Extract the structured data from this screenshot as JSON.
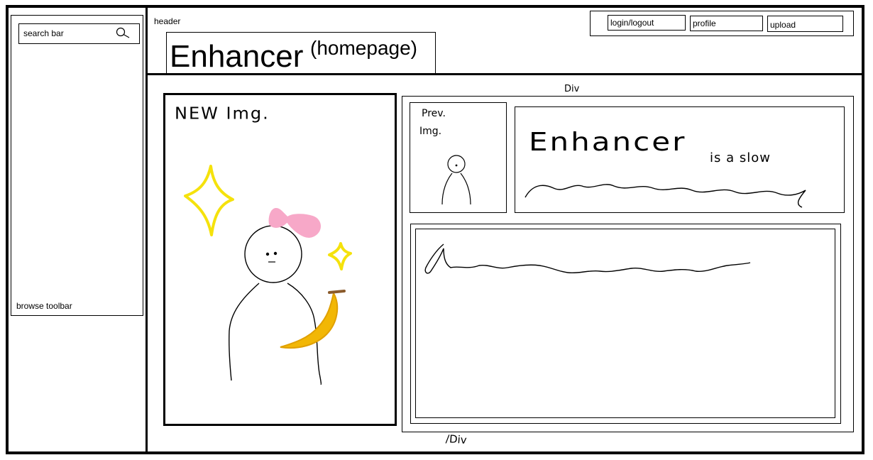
{
  "sidebar": {
    "search_label": "search bar",
    "search_icon": "search-icon",
    "browse_label": "browse toolbar"
  },
  "header": {
    "label": "header",
    "title": "Enhancer",
    "subtitle": "(homepage)"
  },
  "nav": {
    "login": "login/logout",
    "profile": "profile",
    "upload": "upload"
  },
  "main": {
    "new_img_label": "NEW Img.",
    "div_open_label": "Div",
    "div_close_label": "/Div",
    "prev_img_label_line1": "Prev.",
    "prev_img_label_line2": "Img.",
    "description_text": "Enhancer",
    "description_small": "is a slow"
  },
  "colors": {
    "sparkle": "#f5e20c",
    "bow": "#f7a8c8",
    "banana": "#f2b705",
    "banana_stem": "#8a5a2b",
    "ink": "#000000"
  }
}
